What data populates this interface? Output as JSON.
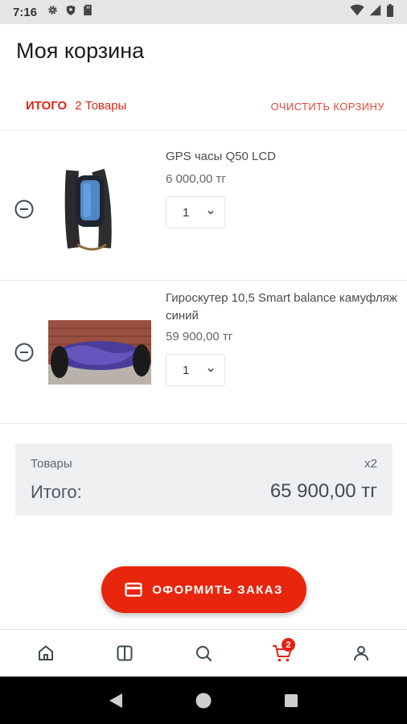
{
  "status_bar": {
    "time": "7:16"
  },
  "header": {
    "title": "Моя корзина"
  },
  "summary": {
    "total_label": "ИТОГО",
    "items_count": "2 Товары",
    "clear_label": "ОЧИСТИТЬ КОРЗИНУ"
  },
  "cart": {
    "items": [
      {
        "name": "GPS часы Q50 LCD",
        "price": "6 000,00 тг",
        "quantity": "1",
        "image": "gps-watch"
      },
      {
        "name": "Гироскутер 10,5 Smart balance камуфляж синий",
        "price": "59 900,00 тг",
        "quantity": "1",
        "image": "hoverboard"
      }
    ]
  },
  "totals": {
    "goods_label": "Товары",
    "goods_count": "x2",
    "total_label": "Итого:",
    "total_value": "65 900,00 тг"
  },
  "checkout": {
    "label": "ОФОРМИТЬ ЗАКАЗ",
    "icon": "credit-card-icon"
  },
  "bottom_nav": {
    "items": [
      {
        "icon": "home-icon"
      },
      {
        "icon": "catalog-icon"
      },
      {
        "icon": "search-icon"
      },
      {
        "icon": "cart-icon",
        "badge": "2",
        "active": true
      },
      {
        "icon": "profile-icon"
      }
    ]
  },
  "colors": {
    "accent": "#e8260e",
    "accent_text": "#e02418",
    "totals_bg": "#eef0f2"
  }
}
